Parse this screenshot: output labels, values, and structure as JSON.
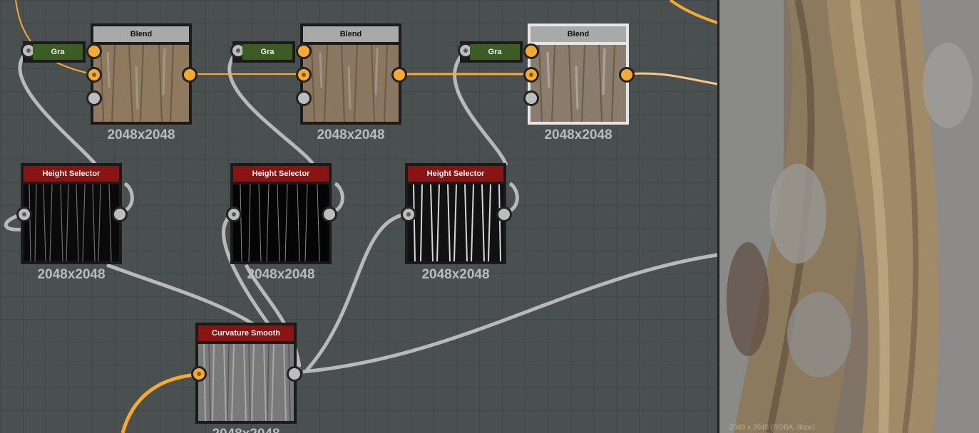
{
  "graph": {
    "blend_title": "Blend",
    "height_selector_title": "Height Selector",
    "curvature_title": "Curvature Smooth",
    "gradient_label": "Gra",
    "resolution": "2048x2048",
    "colors": {
      "port_orange": "#f6a933",
      "port_gray": "#bdbdbd",
      "wire_gray": "#b9b9b9",
      "wire_orange": "#f6a933",
      "header_gray": "#a9a9a9",
      "header_red": "#8a1414",
      "gradient_green": "#3d5c25"
    }
  },
  "viewer": {
    "info": "2048 x 2048 (RGBA, 8bpc)"
  }
}
